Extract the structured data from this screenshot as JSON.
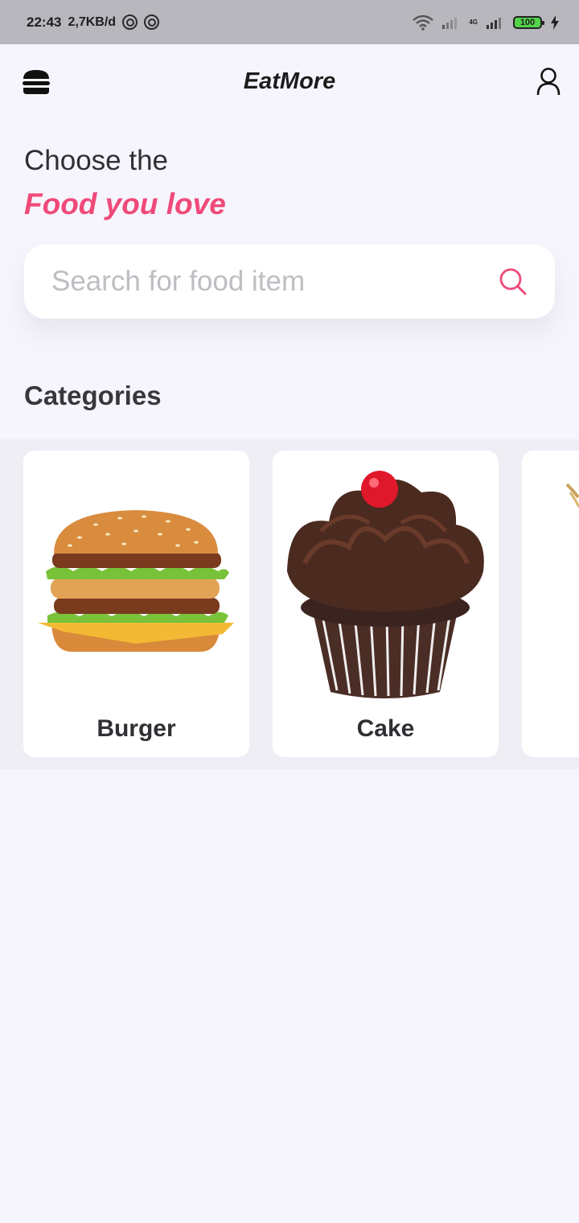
{
  "status_bar": {
    "time": "22:43",
    "net_speed": "2,7KB/d",
    "battery": "100",
    "network_type": "4G"
  },
  "app_bar": {
    "title": "EatMore",
    "menu_icon": "burger-menu-icon",
    "profile_icon": "user-icon"
  },
  "hero": {
    "line1": "Choose the",
    "line2": "Food you love"
  },
  "search": {
    "placeholder": "Search for food item",
    "value": ""
  },
  "categories": {
    "title": "Categories",
    "items": [
      {
        "label": "Burger"
      },
      {
        "label": "Cake"
      }
    ]
  },
  "colors": {
    "accent": "#ef4a79",
    "background": "#f6f5fd"
  }
}
